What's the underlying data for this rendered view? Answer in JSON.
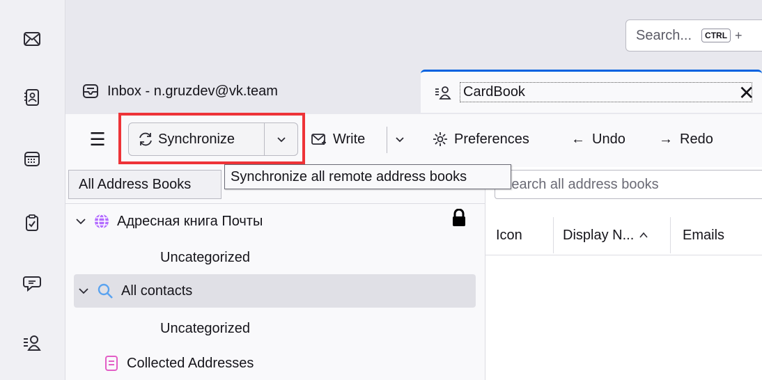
{
  "search": {
    "placeholder": "Search...",
    "shortcut_key": "CTRL",
    "shortcut_plus": "+"
  },
  "tabs": [
    {
      "label": "Inbox - n.gruzdev@vk.team",
      "icon": "inbox-icon"
    },
    {
      "label": "CardBook",
      "icon": "address-book-icon"
    }
  ],
  "tab_close": "✕",
  "toolbar": {
    "menu_icon": "☰",
    "sync_label": "Synchronize",
    "write_label": "Write",
    "preferences_label": "Preferences",
    "undo_label": "Undo",
    "redo_label": "Redo",
    "undo_arrow": "←",
    "redo_arrow": "→"
  },
  "tooltip": "Synchronize all remote address books",
  "address_book_select": "All Address Books",
  "ab_search_placeholder": "Search all address books",
  "tree": [
    {
      "label": "Адресная книга Почты",
      "icon": "globe-icon",
      "locked": true
    },
    {
      "label": "Uncategorized"
    },
    {
      "label": "All contacts",
      "icon": "search-icon"
    },
    {
      "label": "Uncategorized"
    },
    {
      "label": "Collected Addresses",
      "icon": "collected-addresses-icon"
    }
  ],
  "columns": [
    "Icon",
    "Display N...",
    "Emails"
  ],
  "colors": {
    "highlight": "#ee3338",
    "accent": "#0061e0",
    "globe": "#b26bff",
    "collected": "#e35ec6",
    "search": "#5aa3f0"
  }
}
